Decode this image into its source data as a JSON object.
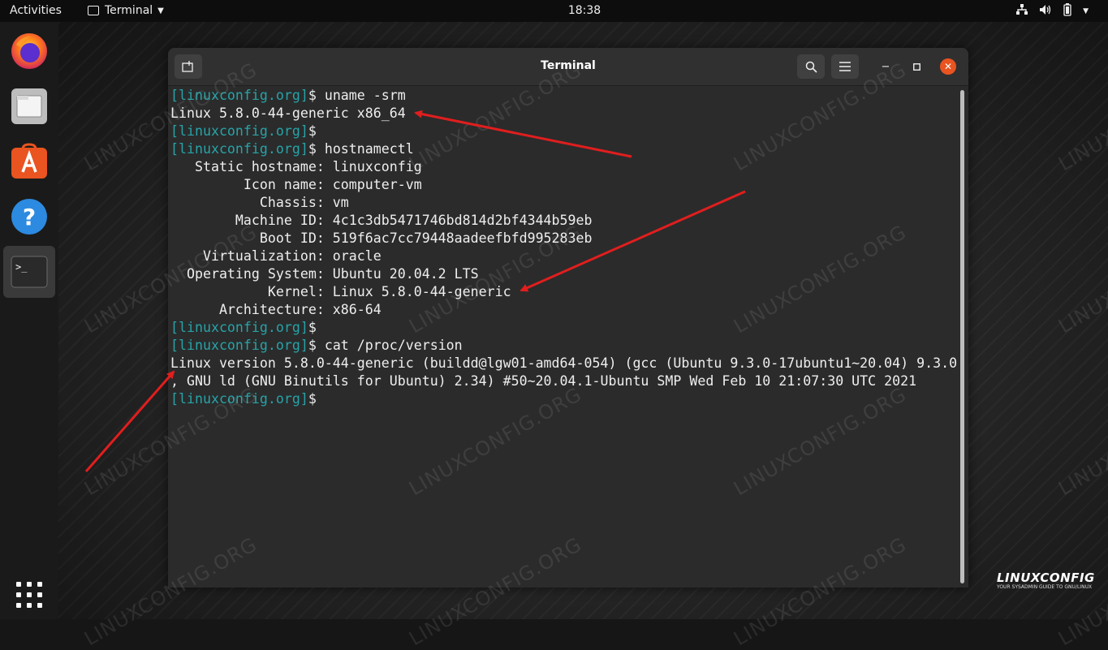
{
  "topbar": {
    "activities": "Activities",
    "app_name": "Terminal",
    "clock": "18:38"
  },
  "dock": {
    "items": [
      "Firefox",
      "Files",
      "Ubuntu Software",
      "Help",
      "Terminal"
    ],
    "show_apps": "Show Applications"
  },
  "window": {
    "title": "Terminal"
  },
  "terminal": {
    "prompt": "[linuxconfig.org]",
    "lines": [
      {
        "prompt": "[linuxconfig.org]",
        "text": "$ uname -srm"
      },
      {
        "prompt": "",
        "text": "Linux 5.8.0-44-generic x86_64"
      },
      {
        "prompt": "[linuxconfig.org]",
        "text": "$"
      },
      {
        "prompt": "[linuxconfig.org]",
        "text": "$ hostnamectl"
      },
      {
        "prompt": "",
        "text": "   Static hostname: linuxconfig"
      },
      {
        "prompt": "",
        "text": "         Icon name: computer-vm"
      },
      {
        "prompt": "",
        "text": "           Chassis: vm"
      },
      {
        "prompt": "",
        "text": "        Machine ID: 4c1c3db5471746bd814d2bf4344b59eb"
      },
      {
        "prompt": "",
        "text": "           Boot ID: 519f6ac7cc79448aadeefbfd995283eb"
      },
      {
        "prompt": "",
        "text": "    Virtualization: oracle"
      },
      {
        "prompt": "",
        "text": "  Operating System: Ubuntu 20.04.2 LTS"
      },
      {
        "prompt": "",
        "text": "            Kernel: Linux 5.8.0-44-generic"
      },
      {
        "prompt": "",
        "text": "      Architecture: x86-64"
      },
      {
        "prompt": "[linuxconfig.org]",
        "text": "$"
      },
      {
        "prompt": "[linuxconfig.org]",
        "text": "$ cat /proc/version"
      },
      {
        "prompt": "",
        "text": "Linux version 5.8.0-44-generic (buildd@lgw01-amd64-054) (gcc (Ubuntu 9.3.0-17ubuntu1~20.04) 9.3.0"
      },
      {
        "prompt": "",
        "text": ", GNU ld (GNU Binutils for Ubuntu) 2.34) #50~20.04.1-Ubuntu SMP Wed Feb 10 21:07:30 UTC 2021"
      },
      {
        "prompt": "[linuxconfig.org]",
        "text": "$ "
      }
    ]
  },
  "watermark": "LINUXCONFIG.ORG",
  "logo": {
    "brand": "LINUXCONFIG",
    "tagline": "YOUR SYSADMIN GUIDE TO GNU/LINUX"
  },
  "colors": {
    "prompt": "#27a3a8",
    "accent": "#e95420",
    "arrow": "#e01e1e"
  }
}
